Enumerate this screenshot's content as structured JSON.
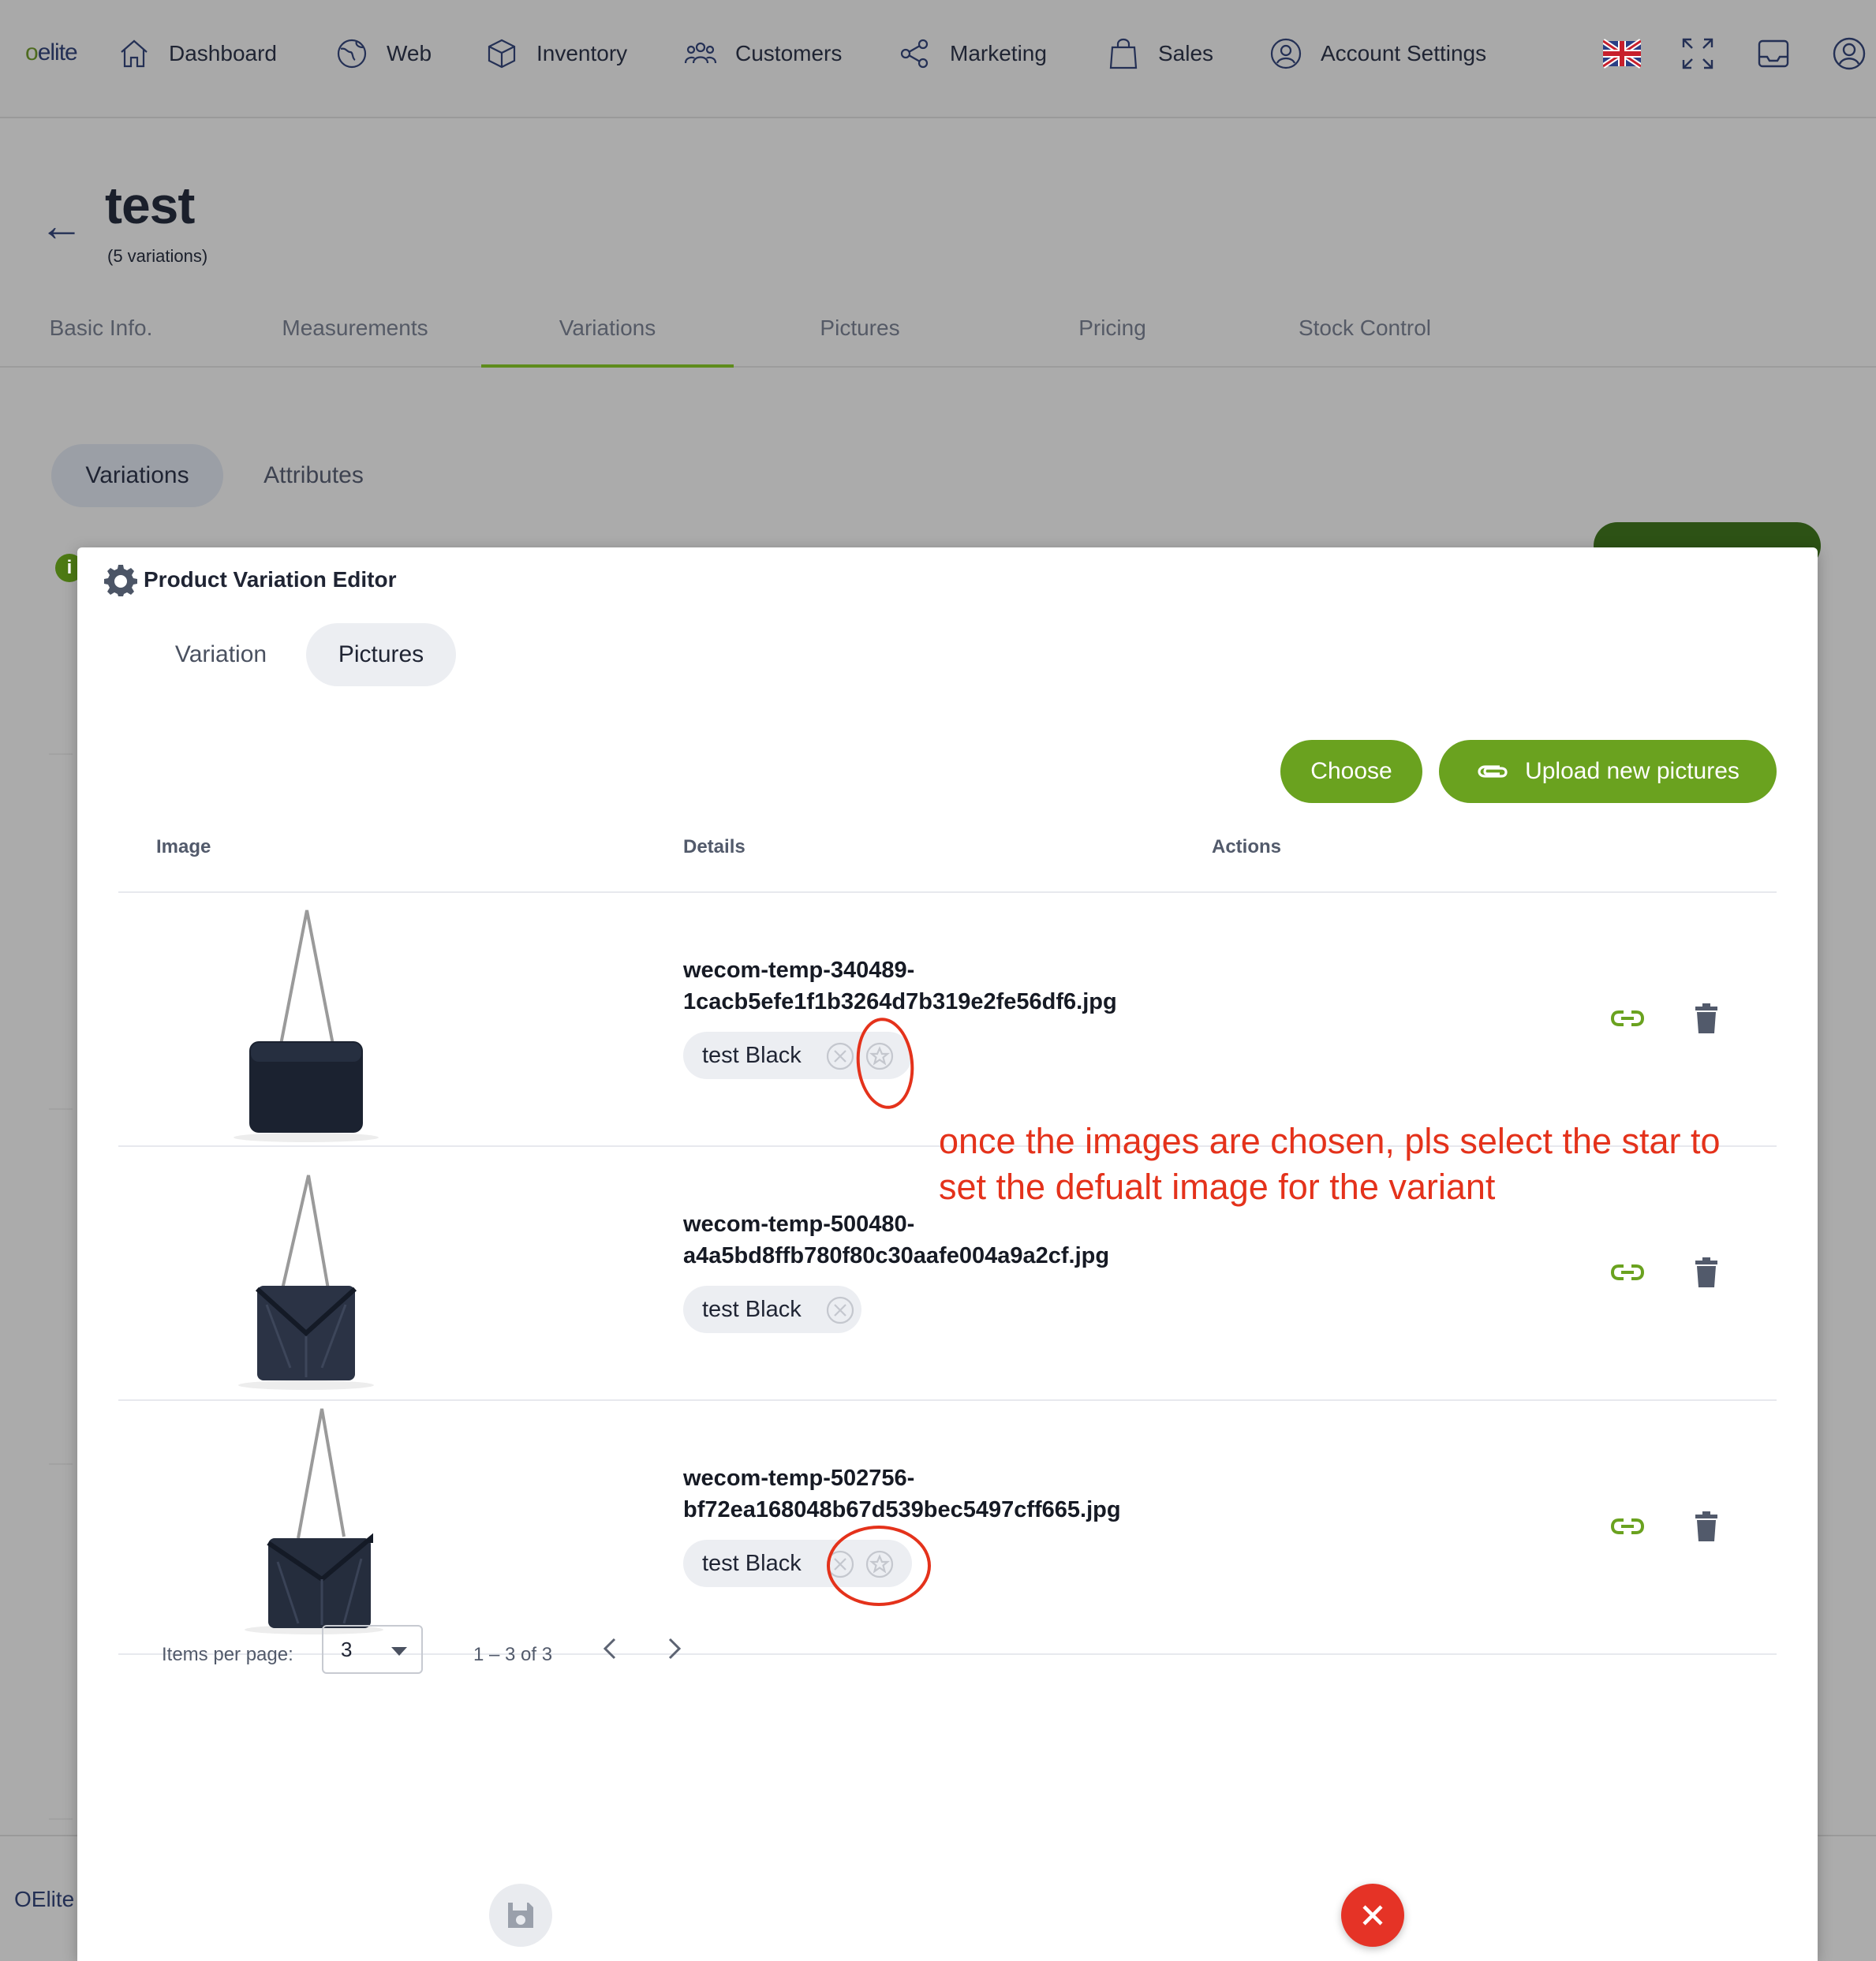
{
  "app": {
    "logo": "oelite",
    "footer_brand": "OElite"
  },
  "nav": [
    {
      "label": "Dashboard",
      "icon": "home-icon"
    },
    {
      "label": "Web",
      "icon": "globe-icon"
    },
    {
      "label": "Inventory",
      "icon": "box-icon"
    },
    {
      "label": "Customers",
      "icon": "users-icon"
    },
    {
      "label": "Marketing",
      "icon": "share-icon"
    },
    {
      "label": "Sales",
      "icon": "shopping-bag-icon"
    },
    {
      "label": "Account Settings",
      "icon": "user-circle-icon"
    }
  ],
  "top_icons": [
    "uk-flag-icon",
    "fullscreen-icon",
    "inbox-icon",
    "profile-icon"
  ],
  "page": {
    "title": "test",
    "subtitle": "(5 variations)"
  },
  "main_tabs": [
    {
      "label": "Basic Info."
    },
    {
      "label": "Measurements"
    },
    {
      "label": "Variations",
      "active": true
    },
    {
      "label": "Pictures"
    },
    {
      "label": "Pricing"
    },
    {
      "label": "Stock Control"
    }
  ],
  "sub_tabs": [
    {
      "label": "Variations",
      "active": true
    },
    {
      "label": "Attributes"
    }
  ],
  "dialog": {
    "title": "Product Variation Editor",
    "tabs": [
      {
        "label": "Variation"
      },
      {
        "label": "Pictures",
        "active": true
      }
    ],
    "buttons": {
      "choose": "Choose",
      "upload": "Upload new pictures"
    },
    "columns": {
      "image": "Image",
      "details": "Details",
      "actions": "Actions"
    },
    "rows": [
      {
        "filename_1": "wecom-temp-340489-",
        "filename_2": "1cacb5efe1f1b3264d7b319e2fe56df6.jpg",
        "chip": "test Black",
        "has_star": true
      },
      {
        "filename_1": "wecom-temp-500480-",
        "filename_2": "a4a5bd8ffb780f80c30aafe004a9a2cf.jpg",
        "chip": "test Black",
        "has_star": false
      },
      {
        "filename_1": "wecom-temp-502756-",
        "filename_2": "bf72ea168048b67d539bec5497cff665.jpg",
        "chip": "test Black",
        "has_star": true
      }
    ],
    "annotation": "once the images are chosen, pls select the star to set the defualt image for the variant",
    "pagination": {
      "label": "Items per page:",
      "per_page": "3",
      "range": "1 – 3 of 3"
    }
  },
  "colors": {
    "accent_green": "#6aa21f",
    "annotation_red": "#e4321b",
    "close_red": "#e53326"
  }
}
